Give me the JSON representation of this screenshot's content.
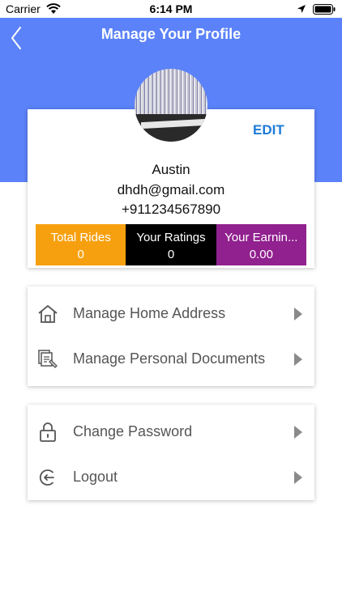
{
  "status_bar": {
    "carrier": "Carrier",
    "time": "6:14 PM"
  },
  "header": {
    "title": "Manage Your Profile",
    "back_icon": "chevron-left-icon"
  },
  "profile": {
    "edit_label": "EDIT",
    "name": "Austin",
    "email": "dhdh@gmail.com",
    "phone": "+911234567890"
  },
  "stats": [
    {
      "label": "Total Rides",
      "value": "0",
      "color": "#f7a00f"
    },
    {
      "label": "Your Ratings",
      "value": "0",
      "color": "#000000"
    },
    {
      "label": "Your Earnin...",
      "value": "0.00",
      "color": "#91218f"
    }
  ],
  "menu_primary": [
    {
      "label": "Manage Home Address",
      "icon": "home-icon"
    },
    {
      "label": "Manage Personal Documents",
      "icon": "documents-icon"
    }
  ],
  "menu_secondary": [
    {
      "label": "Change Password",
      "icon": "lock-icon"
    },
    {
      "label": "Logout",
      "icon": "logout-icon"
    }
  ],
  "colors": {
    "header": "#5b82f8",
    "accent": "#1d7bd6"
  }
}
